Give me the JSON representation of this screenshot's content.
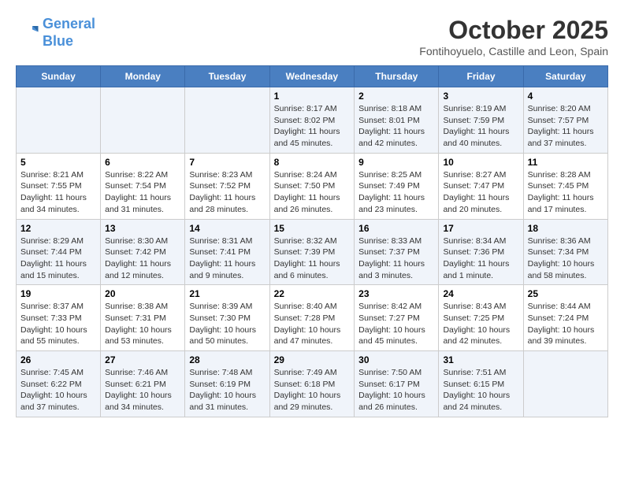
{
  "logo": {
    "line1": "General",
    "line2": "Blue"
  },
  "title": "October 2025",
  "subtitle": "Fontihoyuelo, Castille and Leon, Spain",
  "days_of_week": [
    "Sunday",
    "Monday",
    "Tuesday",
    "Wednesday",
    "Thursday",
    "Friday",
    "Saturday"
  ],
  "weeks": [
    [
      {
        "day": "",
        "info": ""
      },
      {
        "day": "",
        "info": ""
      },
      {
        "day": "",
        "info": ""
      },
      {
        "day": "1",
        "info": "Sunrise: 8:17 AM\nSunset: 8:02 PM\nDaylight: 11 hours and 45 minutes."
      },
      {
        "day": "2",
        "info": "Sunrise: 8:18 AM\nSunset: 8:01 PM\nDaylight: 11 hours and 42 minutes."
      },
      {
        "day": "3",
        "info": "Sunrise: 8:19 AM\nSunset: 7:59 PM\nDaylight: 11 hours and 40 minutes."
      },
      {
        "day": "4",
        "info": "Sunrise: 8:20 AM\nSunset: 7:57 PM\nDaylight: 11 hours and 37 minutes."
      }
    ],
    [
      {
        "day": "5",
        "info": "Sunrise: 8:21 AM\nSunset: 7:55 PM\nDaylight: 11 hours and 34 minutes."
      },
      {
        "day": "6",
        "info": "Sunrise: 8:22 AM\nSunset: 7:54 PM\nDaylight: 11 hours and 31 minutes."
      },
      {
        "day": "7",
        "info": "Sunrise: 8:23 AM\nSunset: 7:52 PM\nDaylight: 11 hours and 28 minutes."
      },
      {
        "day": "8",
        "info": "Sunrise: 8:24 AM\nSunset: 7:50 PM\nDaylight: 11 hours and 26 minutes."
      },
      {
        "day": "9",
        "info": "Sunrise: 8:25 AM\nSunset: 7:49 PM\nDaylight: 11 hours and 23 minutes."
      },
      {
        "day": "10",
        "info": "Sunrise: 8:27 AM\nSunset: 7:47 PM\nDaylight: 11 hours and 20 minutes."
      },
      {
        "day": "11",
        "info": "Sunrise: 8:28 AM\nSunset: 7:45 PM\nDaylight: 11 hours and 17 minutes."
      }
    ],
    [
      {
        "day": "12",
        "info": "Sunrise: 8:29 AM\nSunset: 7:44 PM\nDaylight: 11 hours and 15 minutes."
      },
      {
        "day": "13",
        "info": "Sunrise: 8:30 AM\nSunset: 7:42 PM\nDaylight: 11 hours and 12 minutes."
      },
      {
        "day": "14",
        "info": "Sunrise: 8:31 AM\nSunset: 7:41 PM\nDaylight: 11 hours and 9 minutes."
      },
      {
        "day": "15",
        "info": "Sunrise: 8:32 AM\nSunset: 7:39 PM\nDaylight: 11 hours and 6 minutes."
      },
      {
        "day": "16",
        "info": "Sunrise: 8:33 AM\nSunset: 7:37 PM\nDaylight: 11 hours and 3 minutes."
      },
      {
        "day": "17",
        "info": "Sunrise: 8:34 AM\nSunset: 7:36 PM\nDaylight: 11 hours and 1 minute."
      },
      {
        "day": "18",
        "info": "Sunrise: 8:36 AM\nSunset: 7:34 PM\nDaylight: 10 hours and 58 minutes."
      }
    ],
    [
      {
        "day": "19",
        "info": "Sunrise: 8:37 AM\nSunset: 7:33 PM\nDaylight: 10 hours and 55 minutes."
      },
      {
        "day": "20",
        "info": "Sunrise: 8:38 AM\nSunset: 7:31 PM\nDaylight: 10 hours and 53 minutes."
      },
      {
        "day": "21",
        "info": "Sunrise: 8:39 AM\nSunset: 7:30 PM\nDaylight: 10 hours and 50 minutes."
      },
      {
        "day": "22",
        "info": "Sunrise: 8:40 AM\nSunset: 7:28 PM\nDaylight: 10 hours and 47 minutes."
      },
      {
        "day": "23",
        "info": "Sunrise: 8:42 AM\nSunset: 7:27 PM\nDaylight: 10 hours and 45 minutes."
      },
      {
        "day": "24",
        "info": "Sunrise: 8:43 AM\nSunset: 7:25 PM\nDaylight: 10 hours and 42 minutes."
      },
      {
        "day": "25",
        "info": "Sunrise: 8:44 AM\nSunset: 7:24 PM\nDaylight: 10 hours and 39 minutes."
      }
    ],
    [
      {
        "day": "26",
        "info": "Sunrise: 7:45 AM\nSunset: 6:22 PM\nDaylight: 10 hours and 37 minutes."
      },
      {
        "day": "27",
        "info": "Sunrise: 7:46 AM\nSunset: 6:21 PM\nDaylight: 10 hours and 34 minutes."
      },
      {
        "day": "28",
        "info": "Sunrise: 7:48 AM\nSunset: 6:19 PM\nDaylight: 10 hours and 31 minutes."
      },
      {
        "day": "29",
        "info": "Sunrise: 7:49 AM\nSunset: 6:18 PM\nDaylight: 10 hours and 29 minutes."
      },
      {
        "day": "30",
        "info": "Sunrise: 7:50 AM\nSunset: 6:17 PM\nDaylight: 10 hours and 26 minutes."
      },
      {
        "day": "31",
        "info": "Sunrise: 7:51 AM\nSunset: 6:15 PM\nDaylight: 10 hours and 24 minutes."
      },
      {
        "day": "",
        "info": ""
      }
    ]
  ]
}
